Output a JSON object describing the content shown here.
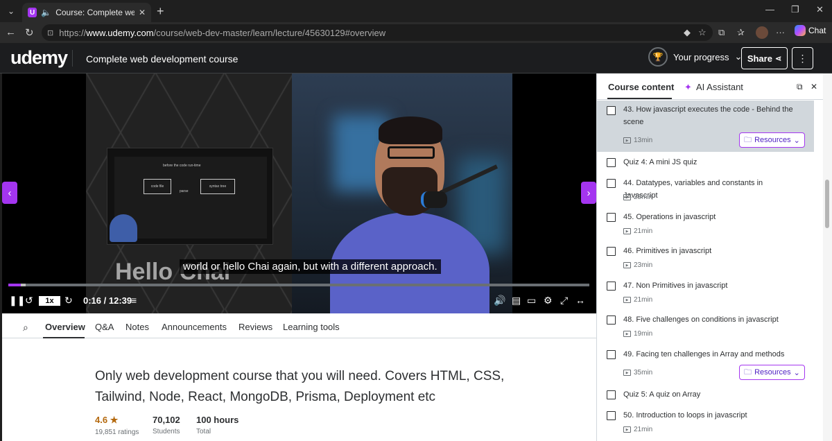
{
  "browser": {
    "tab_title": "Course: Complete web develo",
    "url_prefix": "https://",
    "url_domain": "www.udemy.com",
    "url_path": "/course/web-dev-master/learn/lecture/45630129#overview",
    "chat_label": "Chat"
  },
  "header": {
    "logo": "udemy",
    "course_title": "Complete web development course",
    "progress_label": "Your progress",
    "share_label": "Share"
  },
  "player": {
    "overlay_text": "Hello Chai",
    "screen_heading": "before the code run-time",
    "screen_box1": "code file",
    "screen_box2": "syntax tree",
    "screen_arrow": "parse",
    "subtitle": "world or hello Chai again, but with a different approach.",
    "speed": "1x",
    "time": "0:16 / 12:39",
    "progress_fraction": 0.021,
    "buffer_fraction": 0.03
  },
  "sidebar": {
    "tab_content": "Course content",
    "tab_ai": "AI Assistant",
    "lectures": [
      {
        "title": "43. How javascript executes the code - Behind the scene",
        "meta": "13min",
        "resources": "Resources"
      },
      {
        "title": "Quiz 4: A mini JS quiz"
      },
      {
        "title": "44. Datatypes, variables and constants in Javascript",
        "meta": "25min"
      },
      {
        "title": "45. Operations in javascript",
        "meta": "21min"
      },
      {
        "title": "46. Primitives in javascript",
        "meta": "23min"
      },
      {
        "title": "47. Non Primitives in javascript",
        "meta": "21min"
      },
      {
        "title": "48. Five challenges on conditions in javascript",
        "meta": "19min"
      },
      {
        "title": "49. Facing ten challenges in Array and methods",
        "meta": "35min",
        "resources": "Resources"
      },
      {
        "title": "Quiz 5: A quiz on Array"
      },
      {
        "title": "50. Introduction to loops in javascript",
        "meta": "21min"
      }
    ]
  },
  "bottom": {
    "tabs": [
      "Overview",
      "Q&A",
      "Notes",
      "Announcements",
      "Reviews",
      "Learning tools"
    ],
    "description": "Only web development course that you will need. Covers HTML, CSS, Tailwind, Node, React, MongoDB, Prisma, Deployment etc",
    "rating": "4.6",
    "ratings_count": "19,851 ratings",
    "students": "70,102",
    "students_label": "Students",
    "hours": "100 hours",
    "hours_label": "Total"
  },
  "colors": {
    "accent": "#a435f0",
    "dark": "#1c1d1f",
    "text": "#2d2f31",
    "rating": "#b4690e"
  }
}
